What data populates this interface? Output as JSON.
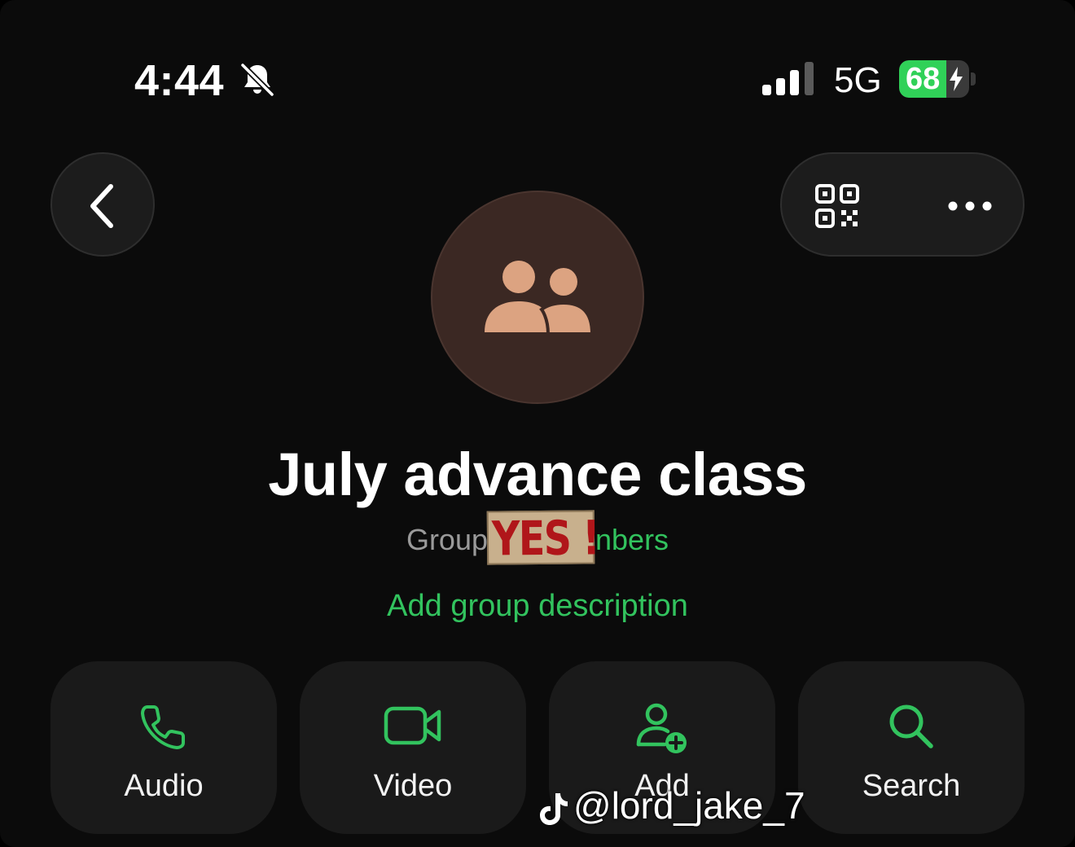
{
  "status_bar": {
    "time": "4:44",
    "network": "5G",
    "battery_percent": "68",
    "battery_level": 0.68,
    "battery_color": "#30d158",
    "icons": [
      "bell-slash-icon",
      "signal-bars-icon",
      "charging-bolt-icon"
    ]
  },
  "header": {
    "back_icon": "chevron-left-icon",
    "qr_icon": "qr-code-icon",
    "more_icon": "ellipsis-icon"
  },
  "group": {
    "avatar_icon": "group-people-icon",
    "name": "July advance class",
    "subtitle_prefix": "Group",
    "subtitle_suffix": "nbers",
    "sticker_text": "YES !",
    "add_description": "Add group description"
  },
  "actions": [
    {
      "label": "Audio",
      "icon": "phone-icon"
    },
    {
      "label": "Video",
      "icon": "video-camera-icon"
    },
    {
      "label": "Add",
      "icon": "add-person-icon"
    },
    {
      "label": "Search",
      "icon": "search-icon"
    }
  ],
  "watermark": {
    "text": "@lord_jake_7",
    "icon": "tiktok-icon"
  },
  "colors": {
    "accent_green": "#32c35e",
    "avatar_bg": "#3b2823",
    "avatar_figure": "#dca381",
    "tile_bg": "#1a1a1a"
  }
}
